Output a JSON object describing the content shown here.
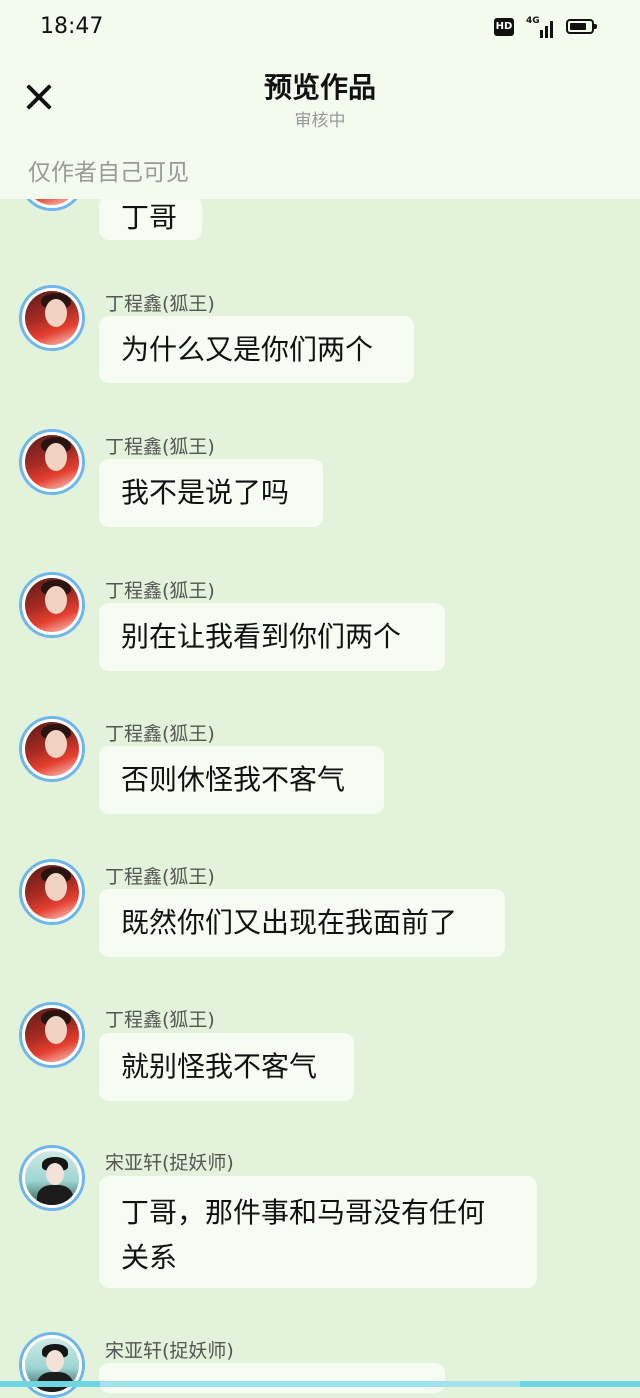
{
  "status_bar": {
    "time": "18:47",
    "hd_label": "HD",
    "network_label": "4G",
    "battery_level": 0.8
  },
  "header": {
    "close_icon": "close-icon",
    "title": "预览作品",
    "subtitle": "审核中",
    "visibility_note": "仅作者自己可见"
  },
  "messages": [
    {
      "sender": "",
      "text": "丁哥",
      "avatar": "avatar-red"
    },
    {
      "sender": "丁程鑫(狐王)",
      "text": "为什么又是你们两个",
      "avatar": "avatar-red"
    },
    {
      "sender": "丁程鑫(狐王)",
      "text": "我不是说了吗",
      "avatar": "avatar-red"
    },
    {
      "sender": "丁程鑫(狐王)",
      "text": "别在让我看到你们两个",
      "avatar": "avatar-red"
    },
    {
      "sender": "丁程鑫(狐王)",
      "text": "否则休怪我不客气",
      "avatar": "avatar-red"
    },
    {
      "sender": "丁程鑫(狐王)",
      "text": "既然你们又出现在我面前了",
      "avatar": "avatar-red"
    },
    {
      "sender": "丁程鑫(狐王)",
      "text": "就别怪我不客气",
      "avatar": "avatar-red"
    },
    {
      "sender": "宋亚轩(捉妖师)",
      "text_line1": "丁哥，那件事和马哥没有任何",
      "text_line2": "关系",
      "avatar": "avatar-green"
    },
    {
      "sender": "宋亚轩(捉妖师)",
      "text": "",
      "avatar": "avatar-green"
    }
  ],
  "colors": {
    "background": "#e3f2da",
    "header_bg": "#f3fbef",
    "bubble_bg": "#f7fcf3",
    "avatar_ring": "#6fb6ea"
  }
}
